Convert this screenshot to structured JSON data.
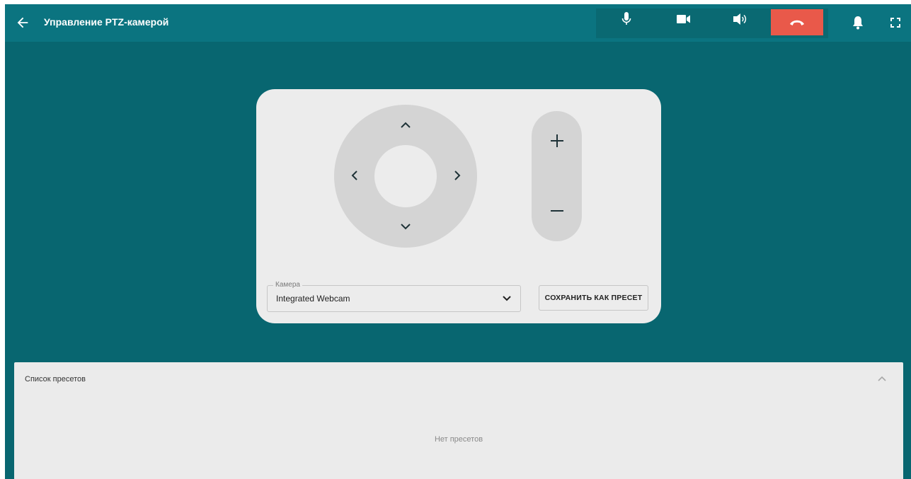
{
  "header": {
    "title": "Управление PTZ-камерой",
    "back_icon": "arrow-left-icon",
    "controls": [
      {
        "name": "microphone",
        "icon": "microphone-icon"
      },
      {
        "name": "camera",
        "icon": "video-camera-icon"
      },
      {
        "name": "speaker",
        "icon": "speaker-icon"
      },
      {
        "name": "hangup",
        "icon": "phone-hangup-icon",
        "color": "#e9594a"
      }
    ],
    "notifications_icon": "bell-icon",
    "fullscreen_icon": "fullscreen-icon"
  },
  "ptz": {
    "pan_tilt": {
      "up_icon": "chevron-up-icon",
      "down_icon": "chevron-down-icon",
      "left_icon": "chevron-left-icon",
      "right_icon": "chevron-right-icon"
    },
    "zoom": {
      "in_label": "+",
      "out_label": "–"
    },
    "camera_select": {
      "label": "Камера",
      "value": "Integrated Webcam"
    },
    "save_preset_label": "СОХРАНИТЬ КАК ПРЕСЕТ"
  },
  "presets": {
    "title": "Список пресетов",
    "empty_text": "Нет пресетов"
  },
  "colors": {
    "header_bg": "#0b7480",
    "page_bg": "#086670",
    "panel_bg": "#ececec",
    "control_bg": "#d4d4d4",
    "hangup": "#e9594a"
  }
}
